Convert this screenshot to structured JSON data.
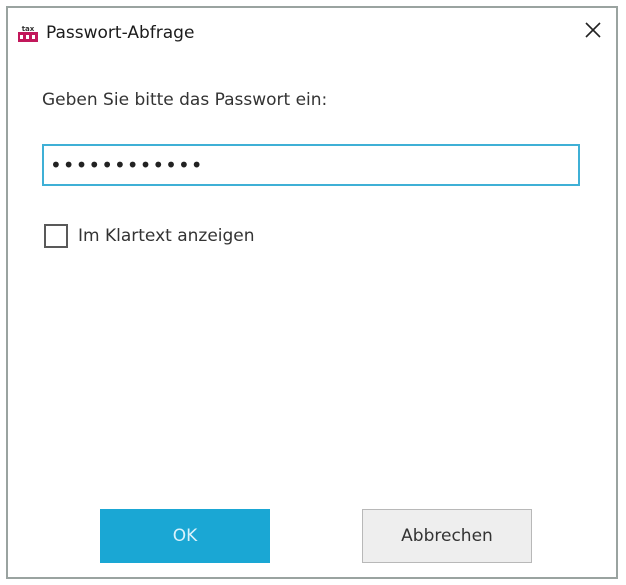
{
  "window": {
    "title": "Passwort-Abfrage",
    "app_icon": "tax-app-icon",
    "close_icon": "close-icon"
  },
  "dialog": {
    "prompt": "Geben Sie bitte das Passwort ein:",
    "password_value": "••••••••••••",
    "show_plaintext_label": "Im Klartext anzeigen",
    "show_plaintext_checked": false
  },
  "buttons": {
    "ok_label": "OK",
    "cancel_label": "Abbrechen"
  },
  "colors": {
    "accent": "#1aa7d4",
    "focus_border": "#3fb0d6",
    "icon_red": "#c2185b"
  }
}
